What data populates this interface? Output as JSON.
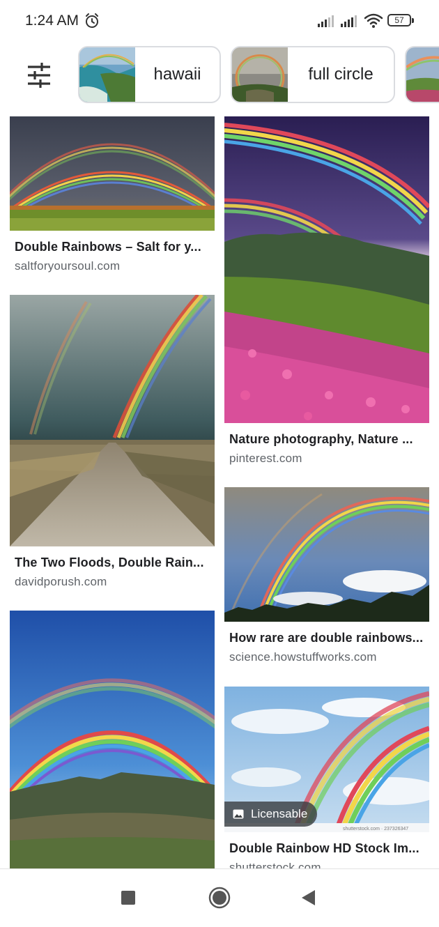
{
  "status_bar": {
    "time": "1:24 AM",
    "battery": "57",
    "icons": [
      "alarm-icon",
      "signal-icon",
      "signal-icon",
      "wifi-icon",
      "battery-icon"
    ]
  },
  "chips": [
    {
      "label": "hawaii",
      "thumb": "hawaii-coast-rainbow"
    },
    {
      "label": "full circle",
      "thumb": "full-circle-rainbow"
    },
    {
      "label": "",
      "thumb": "rainbow-hills"
    }
  ],
  "results": {
    "left": [
      {
        "title": "Double Rainbows – Salt for y...",
        "source": "saltforyoursoul.com",
        "image": "double-rainbow-over-field"
      },
      {
        "title": "The Two Floods, Double Rain...",
        "source": "davidporush.com",
        "image": "double-rainbow-over-road"
      },
      {
        "title": "",
        "source": "",
        "image": "double-rainbow-over-mountain"
      }
    ],
    "right": [
      {
        "title": "Nature photography, Nature ...",
        "source": "pinterest.com",
        "image": "rainbow-over-flower-hillside"
      },
      {
        "title": "How rare are double rainbows...",
        "source": "science.howstuffworks.com",
        "image": "rainbow-over-forest"
      },
      {
        "title": "Double Rainbow HD Stock Im...",
        "source": "shutterstock.com",
        "image": "double-rainbow-sky",
        "badge": "Licensable",
        "watermark": "shutterstock.com · 237326347"
      }
    ]
  },
  "colors": {
    "chip_border": "#dadce0",
    "title": "#202124",
    "source": "#5f6368"
  }
}
